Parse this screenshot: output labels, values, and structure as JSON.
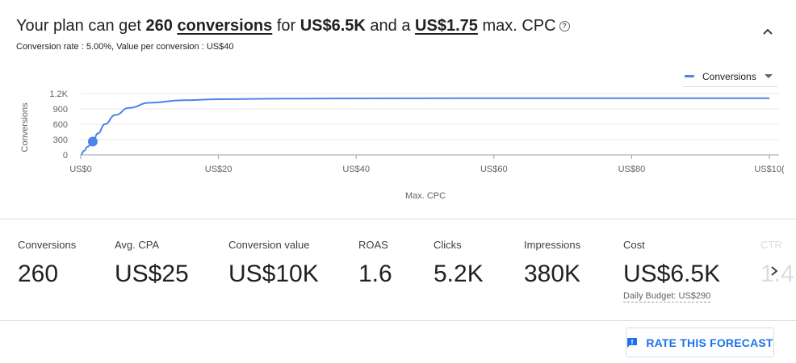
{
  "headline": {
    "pre": "Your plan can get ",
    "conversions_num": "260",
    "conversions_word": "conversions",
    "mid1": " for ",
    "cost": "US$6.5K",
    "mid2": " and a ",
    "cpc": "US$1.75",
    "post": " max. CPC",
    "help_glyph": "?"
  },
  "subline": "Conversion rate : 5.00%, Value per conversion : US$40",
  "legend": {
    "label": "Conversions",
    "color": "#4a86e8"
  },
  "chart_data": {
    "type": "line",
    "ylabel": "Conversions",
    "xlabel": "Max. CPC",
    "y_ticks": [
      "1.2K",
      "900",
      "600",
      "300",
      "0"
    ],
    "y_tick_values": [
      1200,
      900,
      600,
      300,
      0
    ],
    "x_ticks": [
      "US$0",
      "US$20",
      "US$40",
      "US$60",
      "US$80",
      "US$10("
    ],
    "x_tick_values": [
      0,
      20,
      40,
      60,
      80,
      100
    ],
    "ylim": [
      0,
      1200
    ],
    "xlim": [
      0,
      100
    ],
    "grid": true,
    "series": [
      {
        "name": "Conversions",
        "x": [
          0,
          0.5,
          1,
          1.75,
          2.5,
          3.5,
          5,
          7,
          10,
          15,
          20,
          30,
          40,
          55,
          70,
          85,
          100
        ],
        "y": [
          0,
          80,
          160,
          260,
          420,
          600,
          780,
          920,
          1020,
          1070,
          1090,
          1100,
          1105,
          1108,
          1110,
          1110,
          1110
        ]
      }
    ],
    "selected_point": {
      "x": 1.75,
      "y": 260
    }
  },
  "metrics": [
    {
      "label": "Conversions",
      "value": "260"
    },
    {
      "label": "Avg. CPA",
      "value": "US$25"
    },
    {
      "label": "Conversion value",
      "value": "US$10K"
    },
    {
      "label": "ROAS",
      "value": "1.6"
    },
    {
      "label": "Clicks",
      "value": "5.2K"
    },
    {
      "label": "Impressions",
      "value": "380K"
    },
    {
      "label": "Cost",
      "value": "US$6.5K",
      "note": "Daily Budget: US$290"
    },
    {
      "label": "CTR",
      "value": "1.4"
    }
  ],
  "rate_button": {
    "label": "RATE THIS FORECAST"
  }
}
